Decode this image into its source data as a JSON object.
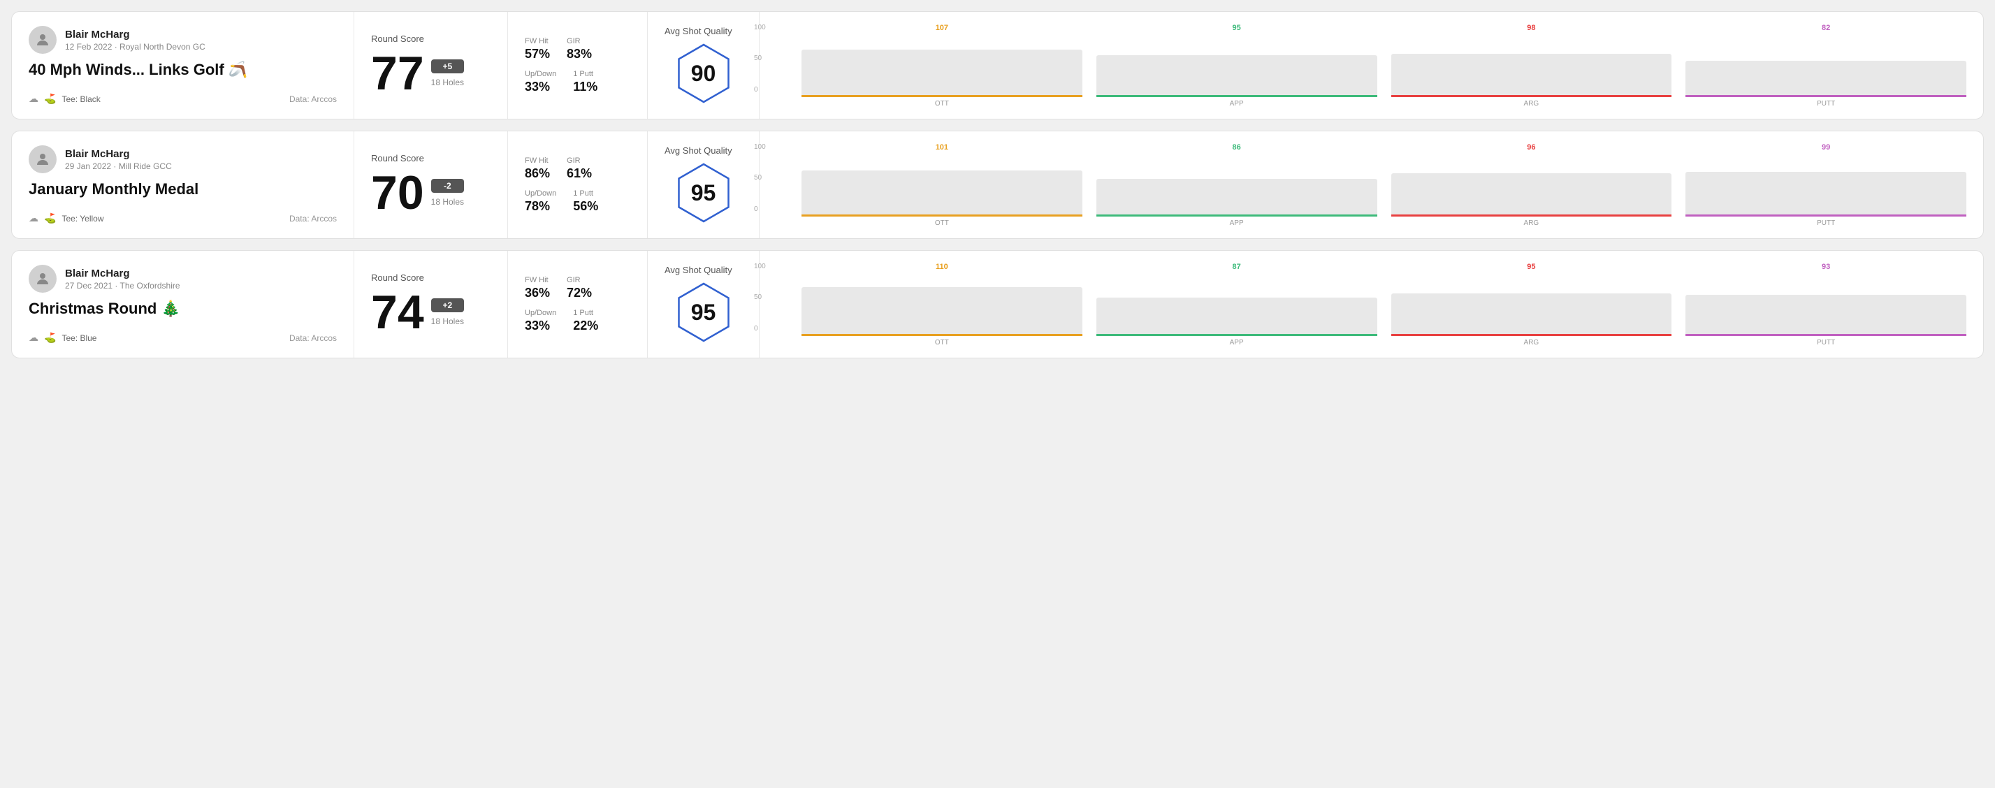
{
  "rounds": [
    {
      "user_name": "Blair McHarg",
      "user_date": "12 Feb 2022 · Royal North Devon GC",
      "round_title": "40 Mph Winds... Links Golf 🪃",
      "tee": "Black",
      "data_source": "Data: Arccos",
      "score": "77",
      "score_diff": "+5",
      "score_holes": "18 Holes",
      "fw_hit_label": "FW Hit",
      "fw_hit_value": "57%",
      "gir_label": "GIR",
      "gir_value": "83%",
      "updown_label": "Up/Down",
      "updown_value": "33%",
      "oneputt_label": "1 Putt",
      "oneputt_value": "11%",
      "quality_label": "Avg Shot Quality",
      "quality_value": "90",
      "chart": {
        "bars": [
          {
            "label": "OTT",
            "value": 107,
            "color_class": "bar-value-ott",
            "line_color": "#e8a020",
            "height_pct": 85
          },
          {
            "label": "APP",
            "value": 95,
            "color_class": "bar-value-app",
            "line_color": "#3dba7a",
            "height_pct": 75
          },
          {
            "label": "ARG",
            "value": 98,
            "color_class": "bar-value-arg",
            "line_color": "#e84040",
            "height_pct": 78
          },
          {
            "label": "PUTT",
            "value": 82,
            "color_class": "bar-value-putt",
            "line_color": "#c060c0",
            "height_pct": 65
          }
        ],
        "y_labels": [
          "100",
          "50",
          "0"
        ]
      }
    },
    {
      "user_name": "Blair McHarg",
      "user_date": "29 Jan 2022 · Mill Ride GCC",
      "round_title": "January Monthly Medal",
      "tee": "Yellow",
      "data_source": "Data: Arccos",
      "score": "70",
      "score_diff": "-2",
      "score_holes": "18 Holes",
      "fw_hit_label": "FW Hit",
      "fw_hit_value": "86%",
      "gir_label": "GIR",
      "gir_value": "61%",
      "updown_label": "Up/Down",
      "updown_value": "78%",
      "oneputt_label": "1 Putt",
      "oneputt_value": "56%",
      "quality_label": "Avg Shot Quality",
      "quality_value": "95",
      "chart": {
        "bars": [
          {
            "label": "OTT",
            "value": 101,
            "color_class": "bar-value-ott",
            "line_color": "#e8a020",
            "height_pct": 82
          },
          {
            "label": "APP",
            "value": 86,
            "color_class": "bar-value-app",
            "line_color": "#3dba7a",
            "height_pct": 68
          },
          {
            "label": "ARG",
            "value": 96,
            "color_class": "bar-value-arg",
            "line_color": "#e84040",
            "height_pct": 77
          },
          {
            "label": "PUTT",
            "value": 99,
            "color_class": "bar-value-putt",
            "line_color": "#c060c0",
            "height_pct": 80
          }
        ],
        "y_labels": [
          "100",
          "50",
          "0"
        ]
      }
    },
    {
      "user_name": "Blair McHarg",
      "user_date": "27 Dec 2021 · The Oxfordshire",
      "round_title": "Christmas Round 🎄",
      "tee": "Blue",
      "data_source": "Data: Arccos",
      "score": "74",
      "score_diff": "+2",
      "score_holes": "18 Holes",
      "fw_hit_label": "FW Hit",
      "fw_hit_value": "36%",
      "gir_label": "GIR",
      "gir_value": "72%",
      "updown_label": "Up/Down",
      "updown_value": "33%",
      "oneputt_label": "1 Putt",
      "oneputt_value": "22%",
      "quality_label": "Avg Shot Quality",
      "quality_value": "95",
      "chart": {
        "bars": [
          {
            "label": "OTT",
            "value": 110,
            "color_class": "bar-value-ott",
            "line_color": "#e8a020",
            "height_pct": 88
          },
          {
            "label": "APP",
            "value": 87,
            "color_class": "bar-value-app",
            "line_color": "#3dba7a",
            "height_pct": 69
          },
          {
            "label": "ARG",
            "value": 95,
            "color_class": "bar-value-arg",
            "line_color": "#e84040",
            "height_pct": 76
          },
          {
            "label": "PUTT",
            "value": 93,
            "color_class": "bar-value-putt",
            "line_color": "#c060c0",
            "height_pct": 74
          }
        ],
        "y_labels": [
          "100",
          "50",
          "0"
        ]
      }
    }
  ]
}
